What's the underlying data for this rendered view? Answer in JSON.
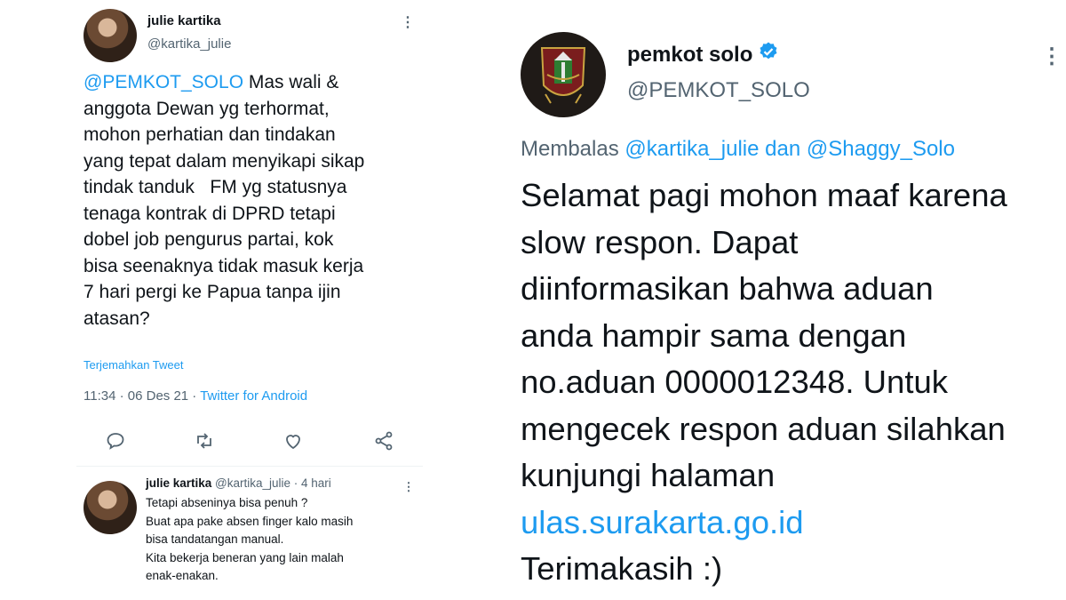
{
  "left_tweet": {
    "author_name": "julie kartika",
    "author_handle": "@kartika_julie",
    "mention": "@PEMKOT_SOLO",
    "text_lines": [
      " Mas wali &",
      "anggota Dewan yg terhormat,",
      "mohon perhatian dan tindakan",
      "yang tepat dalam menyikapi sikap",
      "tindak tanduk   FM yg statusnya",
      "tenaga kontrak di DPRD tetapi",
      "dobel job pengurus partai, kok",
      "bisa seenaknya tidak masuk kerja",
      "7 hari pergi ke Papua tanpa ijin",
      "atasan?"
    ],
    "translate_link": "Terjemahkan Tweet",
    "timestamp": "11:34 · 06 Des 21 · ",
    "client": "Twitter for Android",
    "actions": [
      "reply-icon",
      "retweet-icon",
      "like-icon",
      "share-icon"
    ],
    "reply": {
      "author_name": "julie kartika",
      "author_handle": " @kartika_julie · 4 hari",
      "lines": [
        "Tetapi abseninya bisa penuh ?",
        "Buat apa pake absen finger kalo masih",
        "bisa tandatangan manual.",
        "Kita bekerja beneran yang lain malah",
        "enak-enakan."
      ]
    }
  },
  "right_tweet": {
    "author_name": "pemkot solo",
    "author_handle": "@PEMKOT_SOLO",
    "replying_prefix": "Membalas ",
    "replying_to": "@kartika_julie dan @Shaggy_Solo",
    "body_lines": [
      "Selamat pagi mohon maaf karena",
      "slow respon. Dapat",
      "diinformasikan bahwa aduan",
      "anda hampir sama dengan",
      "no.aduan 0000012348. Untuk",
      "mengecek respon aduan silahkan",
      "kunjungi halaman"
    ],
    "link": "ulas.surakarta.go.id",
    "closing": "Terimakasih :)"
  },
  "colors": {
    "accent": "#1d9bf0",
    "text": "#0f1419",
    "muted": "#536471"
  }
}
